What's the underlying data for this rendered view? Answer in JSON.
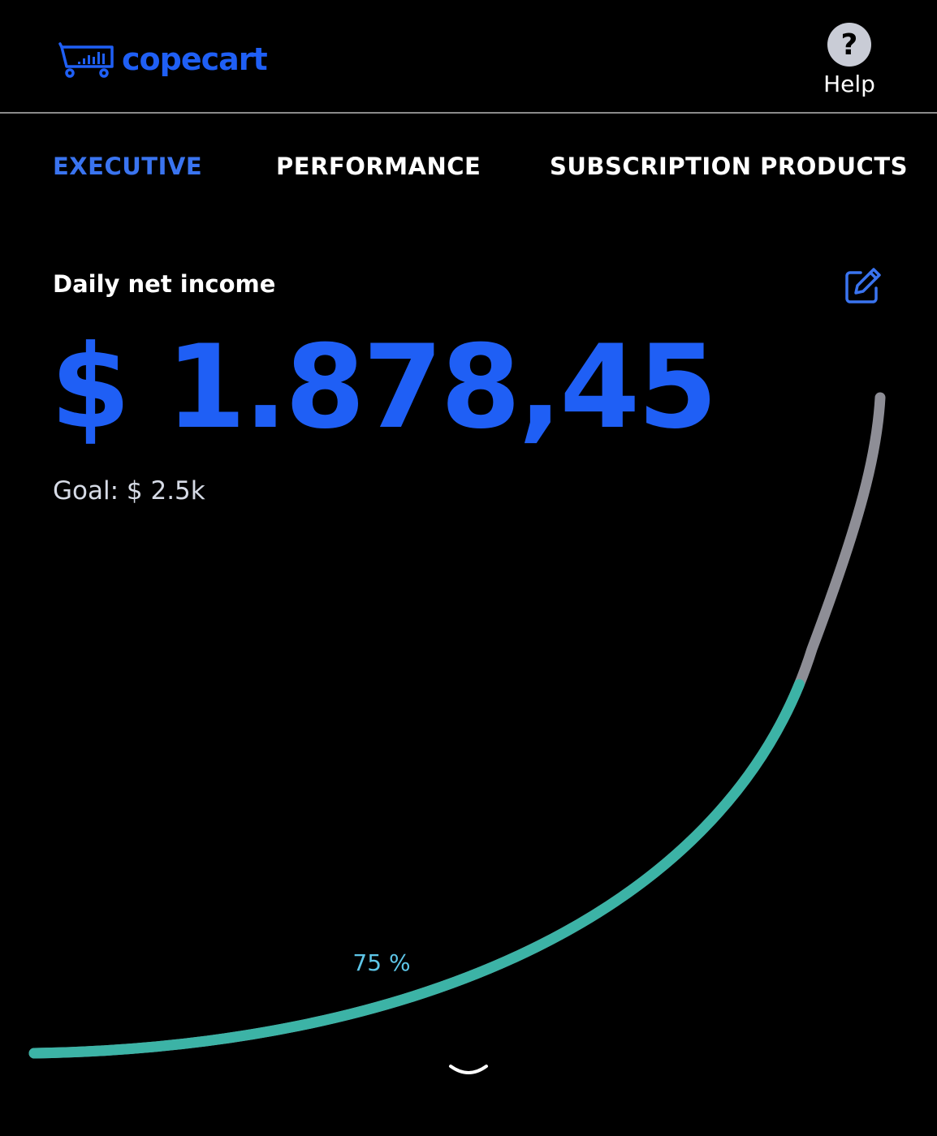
{
  "header": {
    "logo_text": "copecart",
    "help_symbol": "?",
    "help_label": "Help"
  },
  "tabs": [
    {
      "label": "EXECUTIVE",
      "active": true
    },
    {
      "label": "PERFORMANCE",
      "active": false
    },
    {
      "label": "SUBSCRIPTION PRODUCTS",
      "active": false
    }
  ],
  "income_card": {
    "title": "Daily net income",
    "amount": "$ 1.878,45",
    "goal": "Goal: $ 2.5k",
    "progress_label": "75 %",
    "progress_fraction": 0.75
  },
  "icons": {
    "logo": "cart-icon",
    "help": "help-icon",
    "edit": "edit-icon",
    "expand": "chevron-down-icon"
  },
  "colors": {
    "background": "#000000",
    "brand_blue": "#1f5ff5",
    "active_tab": "#3a74f0",
    "text_white": "#ffffff",
    "goal_text": "#d6dbe6",
    "gauge_progress": "#3cb3a6",
    "gauge_track": "#8e8e96",
    "percent_text": "#5ec6e8",
    "help_circle": "#c9ccd6"
  }
}
